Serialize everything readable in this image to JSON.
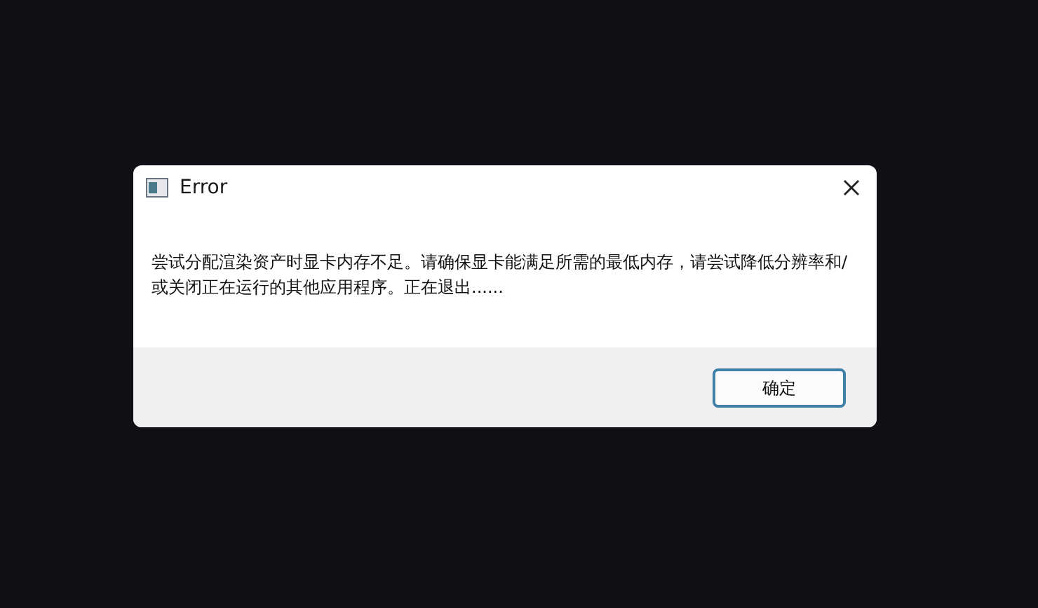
{
  "window": {
    "title": "Error"
  },
  "message": "尝试分配渲染资产时显卡内存不足。请确保显卡能满足所需的最低内存，请尝试降低分辨率和/或关闭正在运行的其他应用程序。正在退出......",
  "buttons": [
    "确定"
  ]
}
